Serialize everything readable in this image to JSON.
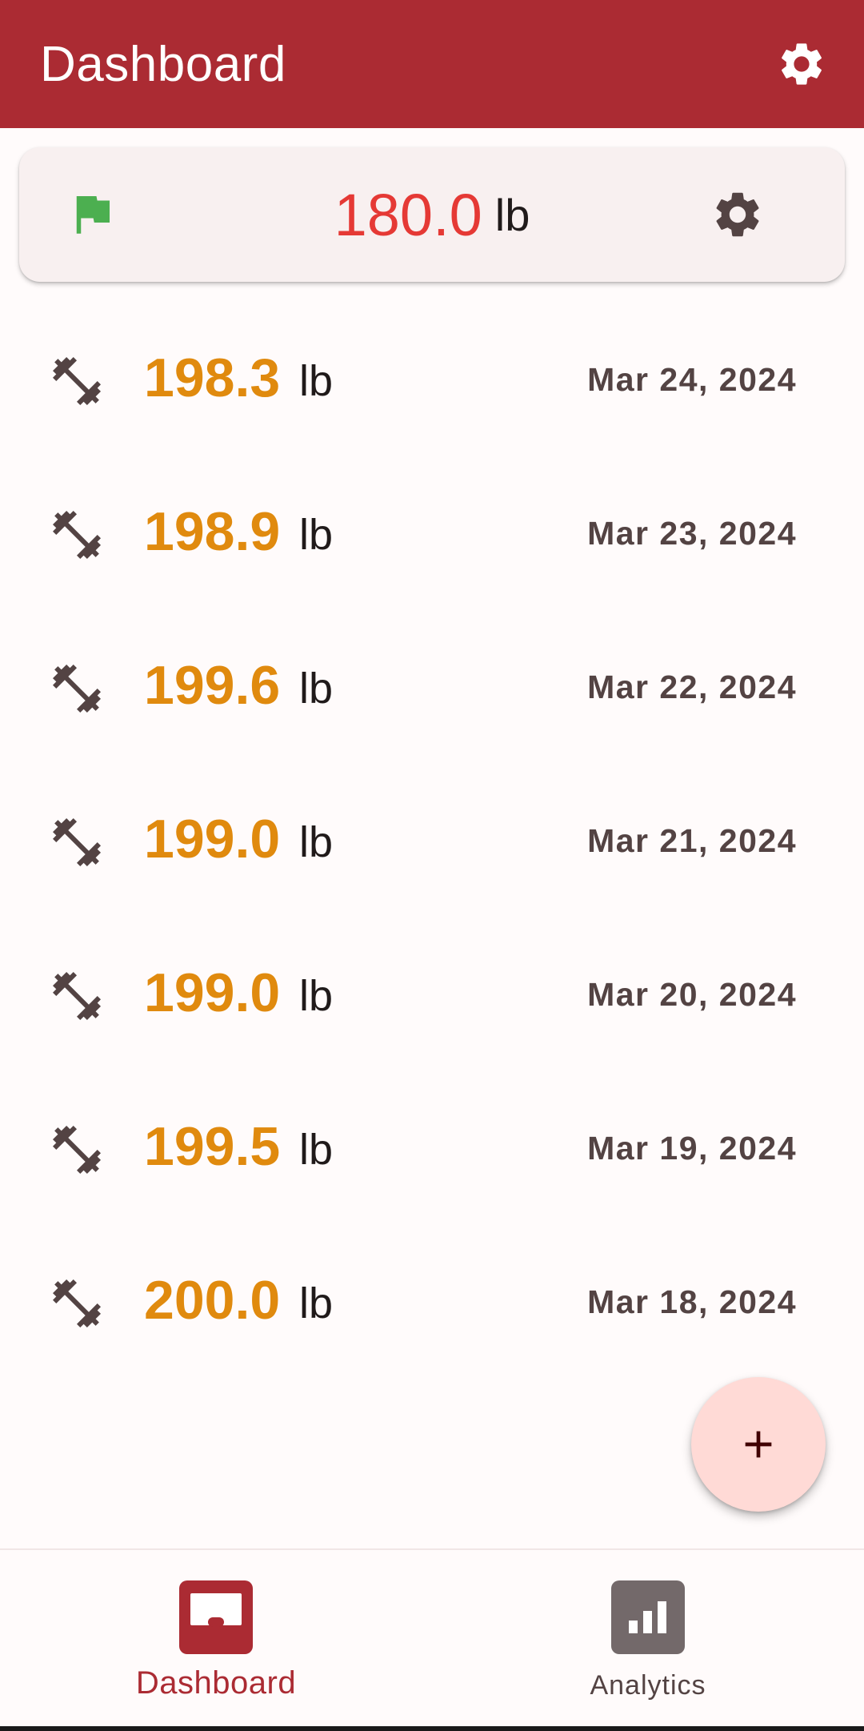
{
  "app_bar": {
    "title": "Dashboard",
    "settings_icon": "settings-gear-icon",
    "background_color": "#ab2b33"
  },
  "goal_card": {
    "flag_icon": "flag-icon",
    "flag_color": "#4caf50",
    "value": "180.0",
    "unit": "lb",
    "value_color": "#e53935",
    "settings_icon": "settings-gear-icon"
  },
  "entries": [
    {
      "value": "198.3",
      "unit": "lb",
      "date": "Mar 24, 2024",
      "icon": "dumbbell-icon"
    },
    {
      "value": "198.9",
      "unit": "lb",
      "date": "Mar 23, 2024",
      "icon": "dumbbell-icon"
    },
    {
      "value": "199.6",
      "unit": "lb",
      "date": "Mar 22, 2024",
      "icon": "dumbbell-icon"
    },
    {
      "value": "199.0",
      "unit": "lb",
      "date": "Mar 21, 2024",
      "icon": "dumbbell-icon"
    },
    {
      "value": "199.0",
      "unit": "lb",
      "date": "Mar 20, 2024",
      "icon": "dumbbell-icon"
    },
    {
      "value": "199.5",
      "unit": "lb",
      "date": "Mar 19, 2024",
      "icon": "dumbbell-icon"
    },
    {
      "value": "200.0",
      "unit": "lb",
      "date": "Mar 18, 2024",
      "icon": "dumbbell-icon"
    }
  ],
  "entry_value_color": "#e08a0e",
  "fab": {
    "icon": "plus-icon",
    "background_color": "#ffdad6"
  },
  "bottom_nav": {
    "items": [
      {
        "label": "Dashboard",
        "icon": "inbox-icon",
        "selected": true
      },
      {
        "label": "Analytics",
        "icon": "analytics-icon",
        "selected": false
      }
    ]
  }
}
